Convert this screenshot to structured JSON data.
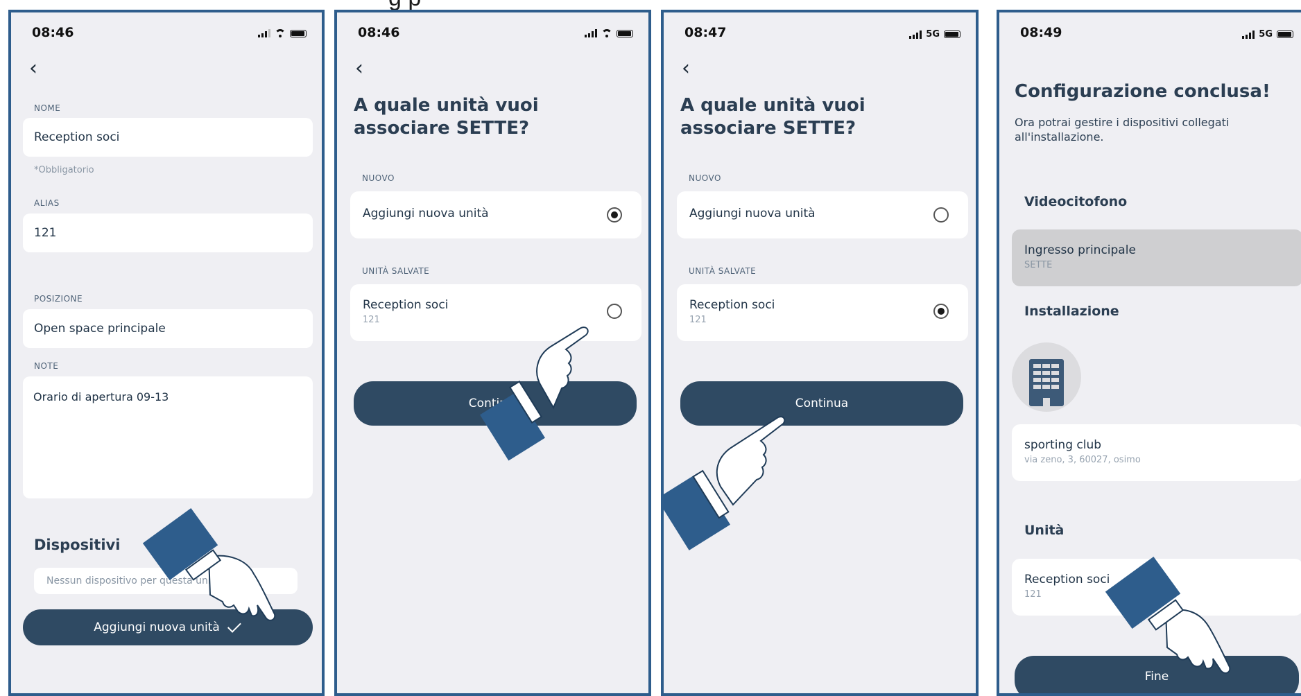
{
  "caption": "g   p",
  "screen1": {
    "time": "08:46",
    "nome_label": "NOME",
    "nome_value": "Reception soci",
    "required_hint": "*Obbligatorio",
    "alias_label": "ALIAS",
    "alias_value": "121",
    "posizione_label": "POSIZIONE",
    "posizione_value": "Open space principale",
    "note_label": "NOTE",
    "note_value": "Orario di apertura 09-13",
    "devices_title": "Dispositivi",
    "devices_empty": "Nessun dispositivo per questa unità.",
    "add_button": "Aggiungi nuova unità"
  },
  "screen2": {
    "time": "08:46",
    "question": "A quale unità vuoi associare SETTE?",
    "nuovo_label": "NUOVO",
    "new_option": "Aggiungi nuova unità",
    "saved_label": "UNITÀ SALVATE",
    "saved_title": "Reception soci",
    "saved_sub": "121",
    "continue_button": "Continua",
    "selected": "new"
  },
  "screen3": {
    "time": "08:47",
    "network": "5G",
    "question": "A quale unità vuoi associare SETTE?",
    "nuovo_label": "NUOVO",
    "new_option": "Aggiungi nuova unità",
    "saved_label": "UNITÀ SALVATE",
    "saved_title": "Reception soci",
    "saved_sub": "121",
    "continue_button": "Continua",
    "selected": "saved"
  },
  "screen4": {
    "time": "08:49",
    "network": "5G",
    "title": "Configurazione conclusa!",
    "subtitle": "Ora potrai gestire i dispositivi collegati all'installazione.",
    "videocitofono_title": "Videocitofono",
    "device_title": "Ingresso principale",
    "device_sub": "SETTE",
    "installazione_title": "Installazione",
    "install_name": "sporting club",
    "install_address": "via zeno, 3, 60027, osimo",
    "unita_title": "Unità",
    "unit_title": "Reception soci",
    "unit_sub": "121",
    "finish_button": "Fine"
  },
  "colors": {
    "frame": "#2e5d8c",
    "screen_bg": "#efeff3",
    "primary_button": "#2f4a63",
    "text_dark": "#2b3e52",
    "selected_card": "#cfcfd1",
    "building_icon": "#3d5a78"
  },
  "icons": [
    "back-chevron-icon",
    "cellular-signal-icon",
    "wifi-icon",
    "battery-icon",
    "checkmark-icon",
    "building-icon",
    "pointing-hand-icon"
  ]
}
